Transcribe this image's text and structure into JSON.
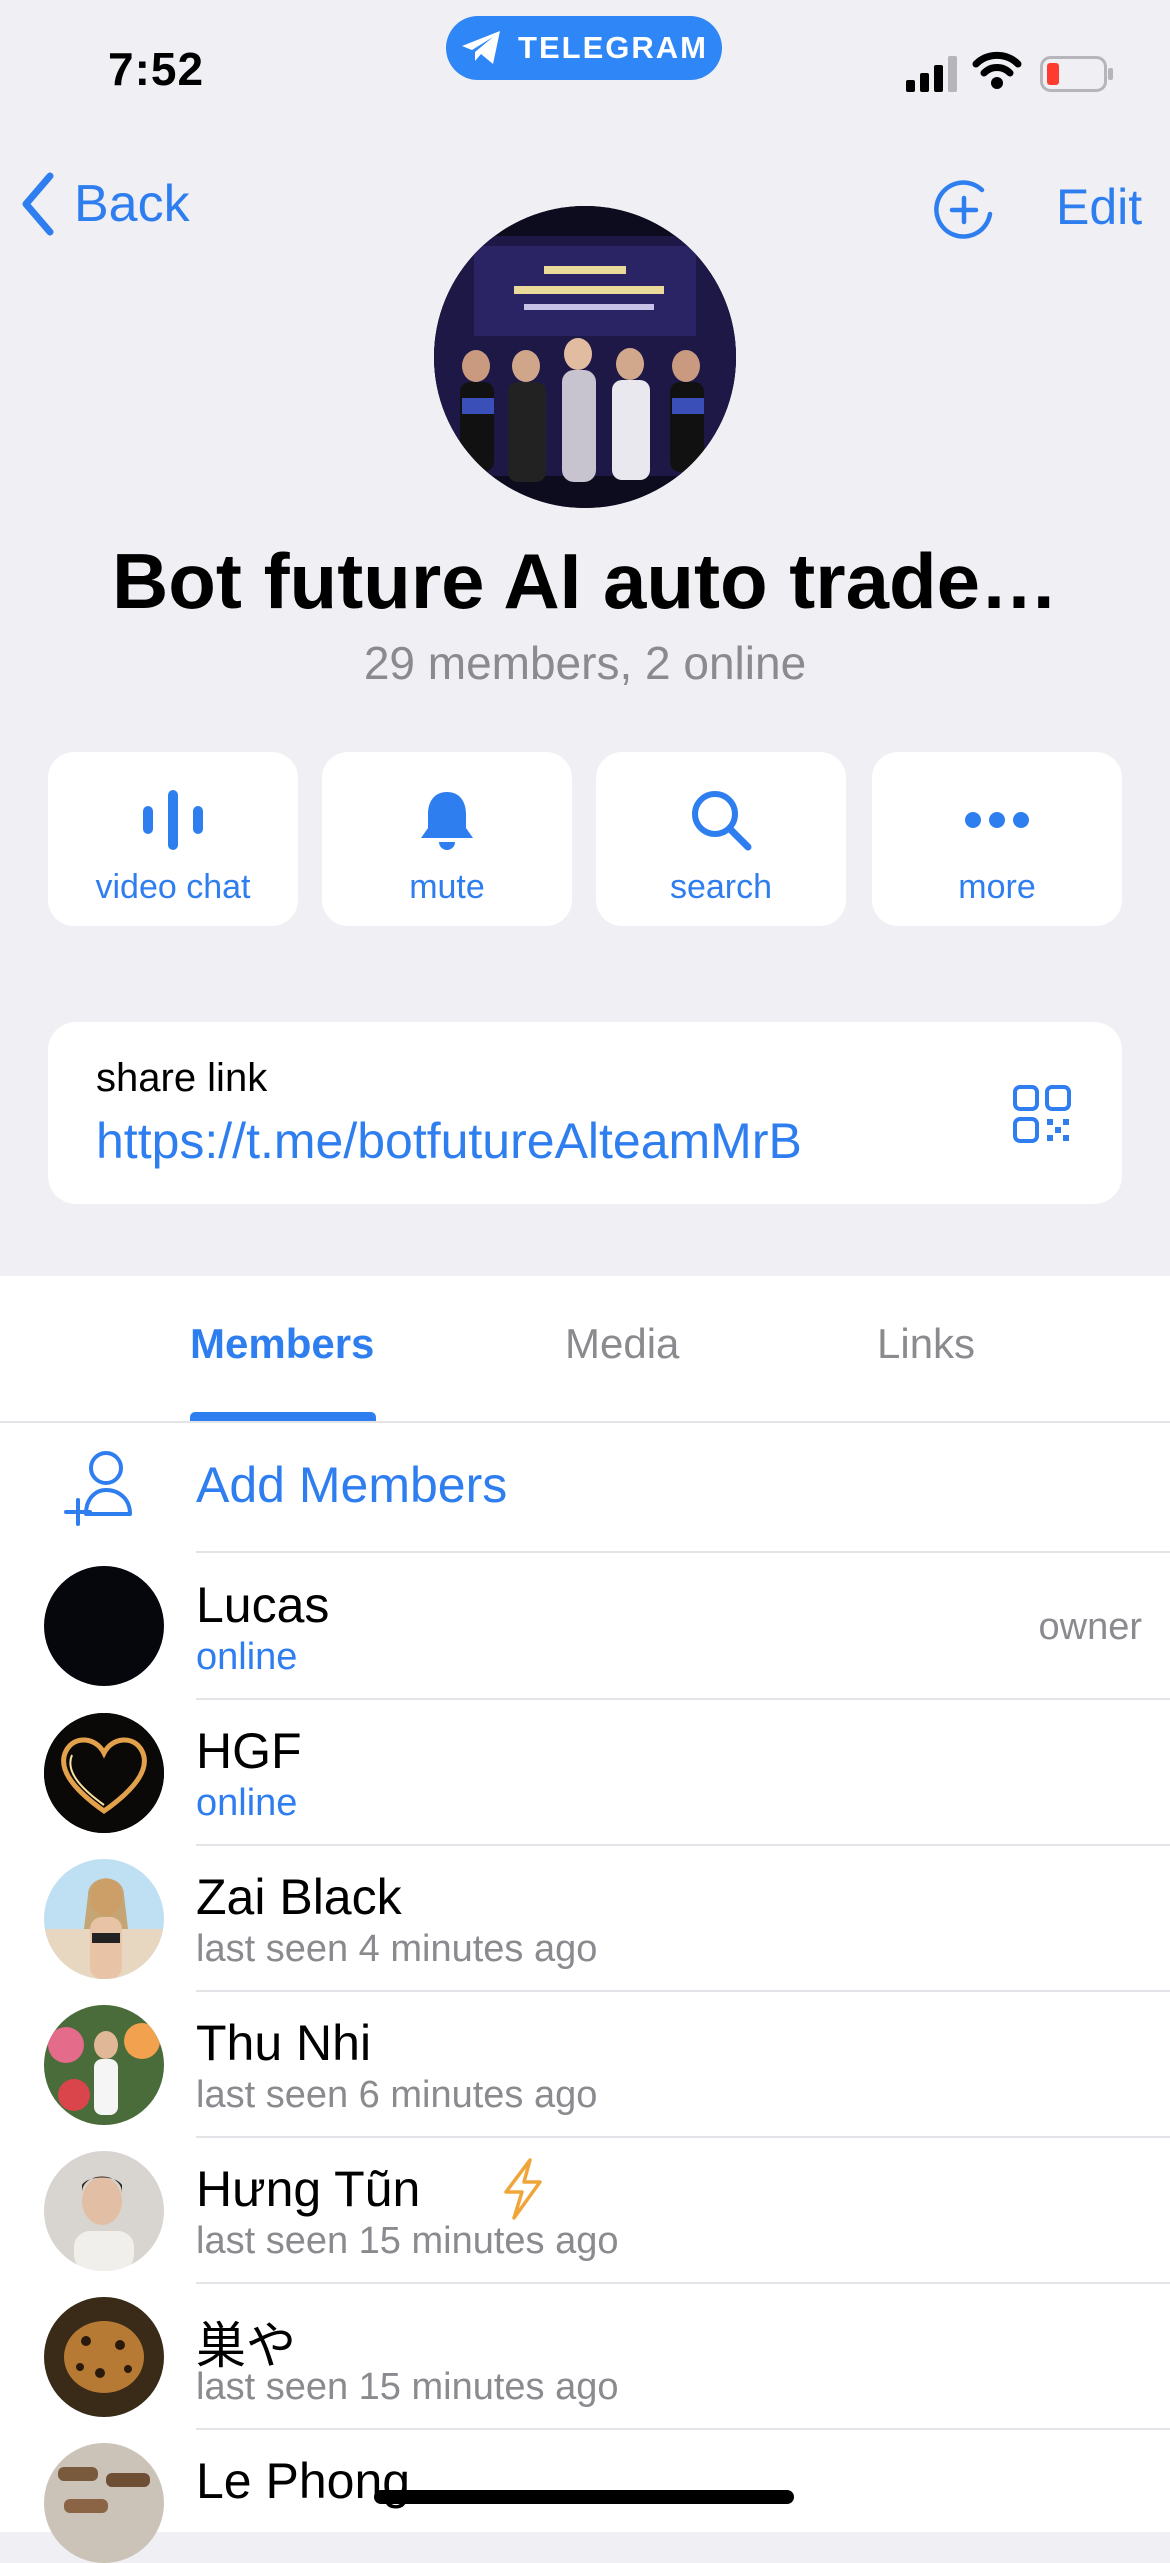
{
  "status_bar": {
    "time": "7:52",
    "app_pill": "TELEGRAM"
  },
  "nav": {
    "back_label": "Back",
    "edit_label": "Edit"
  },
  "group": {
    "title": "Bot future AI auto trade…",
    "subtitle": "29 members, 2 online"
  },
  "actions": [
    {
      "label": "video chat",
      "icon": "video-chat-icon"
    },
    {
      "label": "mute",
      "icon": "bell-icon"
    },
    {
      "label": "search",
      "icon": "search-icon"
    },
    {
      "label": "more",
      "icon": "more-icon"
    }
  ],
  "share": {
    "label": "share link",
    "url": "https://t.me/botfutureAlteamMrB"
  },
  "tabs": [
    {
      "label": "Members",
      "active": true
    },
    {
      "label": "Media",
      "active": false
    },
    {
      "label": "Links",
      "active": false
    }
  ],
  "add_members_label": "Add Members",
  "members": [
    {
      "name": "Lucas",
      "status": "online",
      "online": true,
      "role": "owner"
    },
    {
      "name": "HGF",
      "status": "online",
      "online": true,
      "role": ""
    },
    {
      "name": "Zai Black",
      "status": "last seen 4 minutes ago",
      "online": false,
      "role": ""
    },
    {
      "name": "Thu Nhi",
      "status": "last seen 6 minutes ago",
      "online": false,
      "role": ""
    },
    {
      "name": "Hưng Tũn",
      "status": "last seen 15 minutes ago",
      "online": false,
      "role": ""
    },
    {
      "name": "巣や",
      "status": "last seen 15 minutes ago",
      "online": false,
      "role": ""
    },
    {
      "name": "Le Phong",
      "status": "",
      "online": false,
      "role": ""
    }
  ],
  "colors": {
    "accent": "#2f7ef0",
    "background": "#efeff4",
    "secondary_text": "#8a8a8f"
  }
}
